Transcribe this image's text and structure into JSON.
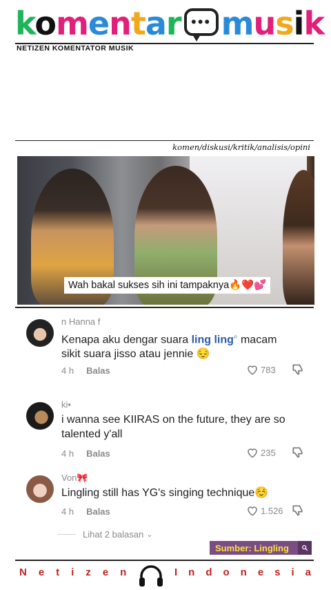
{
  "header": {
    "logo_parts": [
      "k",
      "o",
      "m",
      "e",
      "n",
      "t",
      "a",
      "r",
      "m",
      "u",
      "s",
      "i",
      "k"
    ],
    "logo_colors": [
      "#1fb35a",
      "#111111",
      "#e0207a",
      "#2a8ad8",
      "#e0207a",
      "#f0a91c",
      "#2a8ad8",
      "#1fb35a",
      "#2a8ad8",
      "#e0207a",
      "#f0a91c",
      "#111111",
      "#e0207a"
    ],
    "tagline": "NETIZEN KOMENTATOR MUSIK",
    "categories": "komen/diskusi/kritik/analisis/opini"
  },
  "video": {
    "caption": "Wah bakal sukses sih ini tampaknya🔥❤️💕"
  },
  "comments": [
    {
      "user": "n Hanna f",
      "text_before": "Kenapa aku dengar suara ",
      "highlight": "ling ling",
      "text_after": " macam sikit suara jisso atau jennie 😔",
      "time": "4 h",
      "reply": "Balas",
      "likes": "783"
    },
    {
      "user": "ki•",
      "text": "i wanna see KIIRAS on the future, they are so talented y'all",
      "time": "4 h",
      "reply": "Balas",
      "likes": "235"
    },
    {
      "user": "Von🎀",
      "text": "Lingling still has YG's singing technique☺️",
      "time": "4 h",
      "reply": "Balas",
      "likes": "1.526"
    }
  ],
  "more_replies": "Lihat 2 balasan",
  "source": {
    "label": "Sumber: Lingling",
    "icon": "search-icon"
  },
  "footer": {
    "left": "Netizen",
    "right": "Indonesia",
    "icon": "headphones-icon",
    "color": "#c0221f"
  }
}
